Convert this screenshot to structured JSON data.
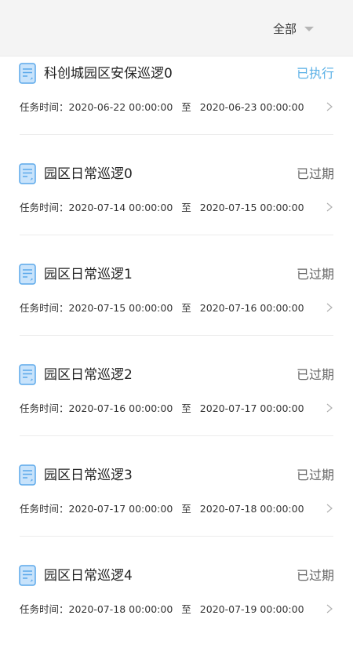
{
  "header": {
    "filter_label": "全部"
  },
  "colors": {
    "executed": "#5ab0e6",
    "expired": "#666666",
    "icon_fill": "#c8e3fb",
    "icon_stroke": "#5aa8ea"
  },
  "tasks": [
    {
      "title": "科创城园区安保巡逻0",
      "status": "已执行",
      "status_type": "executed",
      "time_label": "任务时间：",
      "start": "2020-06-22 00:00:00",
      "sep": "至",
      "end": "2020-06-23 00:00:00"
    },
    {
      "title": "园区日常巡逻0",
      "status": "已过期",
      "status_type": "expired",
      "time_label": "任务时间：",
      "start": "2020-07-14 00:00:00",
      "sep": "至",
      "end": "2020-07-15 00:00:00"
    },
    {
      "title": "园区日常巡逻1",
      "status": "已过期",
      "status_type": "expired",
      "time_label": "任务时间：",
      "start": "2020-07-15 00:00:00",
      "sep": "至",
      "end": "2020-07-16 00:00:00"
    },
    {
      "title": "园区日常巡逻2",
      "status": "已过期",
      "status_type": "expired",
      "time_label": "任务时间：",
      "start": "2020-07-16 00:00:00",
      "sep": "至",
      "end": "2020-07-17 00:00:00"
    },
    {
      "title": "园区日常巡逻3",
      "status": "已过期",
      "status_type": "expired",
      "time_label": "任务时间：",
      "start": "2020-07-17 00:00:00",
      "sep": "至",
      "end": "2020-07-18 00:00:00"
    },
    {
      "title": "园区日常巡逻4",
      "status": "已过期",
      "status_type": "expired",
      "time_label": "任务时间：",
      "start": "2020-07-18 00:00:00",
      "sep": "至",
      "end": "2020-07-19 00:00:00"
    }
  ]
}
